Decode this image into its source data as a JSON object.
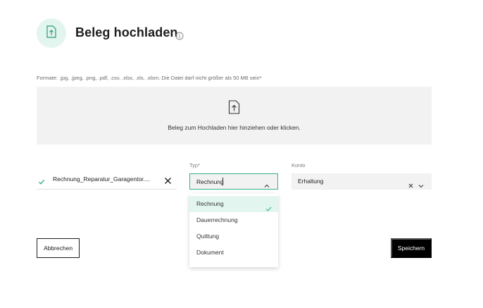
{
  "header": {
    "title": "Beleg hochladen",
    "upload_icon": "document-upload-icon",
    "info_icon": "info-icon"
  },
  "upload": {
    "formats_hint": "Formate: .jpg, .jpeg, .png, .pdf, .csv, .xlsx, .xls, .xlsm. Die Datei darf nicht größer als 50 MB sein*",
    "dropzone_text": "Beleg zum Hochladen hier hinziehen oder klicken.",
    "dropzone_icon": "upload-file-icon"
  },
  "file": {
    "name": "Rechnung_Reparatur_Garagentor....",
    "status_icon": "check-icon",
    "remove_icon": "close-icon"
  },
  "typ": {
    "label": "Typ*",
    "value": "Rechnung",
    "options": [
      "Rechnung",
      "Dauerrechnung",
      "Quittung",
      "Dokument"
    ],
    "selected_index": 0
  },
  "konto": {
    "label": "Konto",
    "value": "Erhaltung"
  },
  "actions": {
    "cancel_label": "Abbrechen",
    "save_label": "Speichern"
  },
  "colors": {
    "accent": "#34b383",
    "accent_light": "#e2f5ee",
    "field_bg": "#f2f2f3",
    "primary_button": "#000000"
  }
}
